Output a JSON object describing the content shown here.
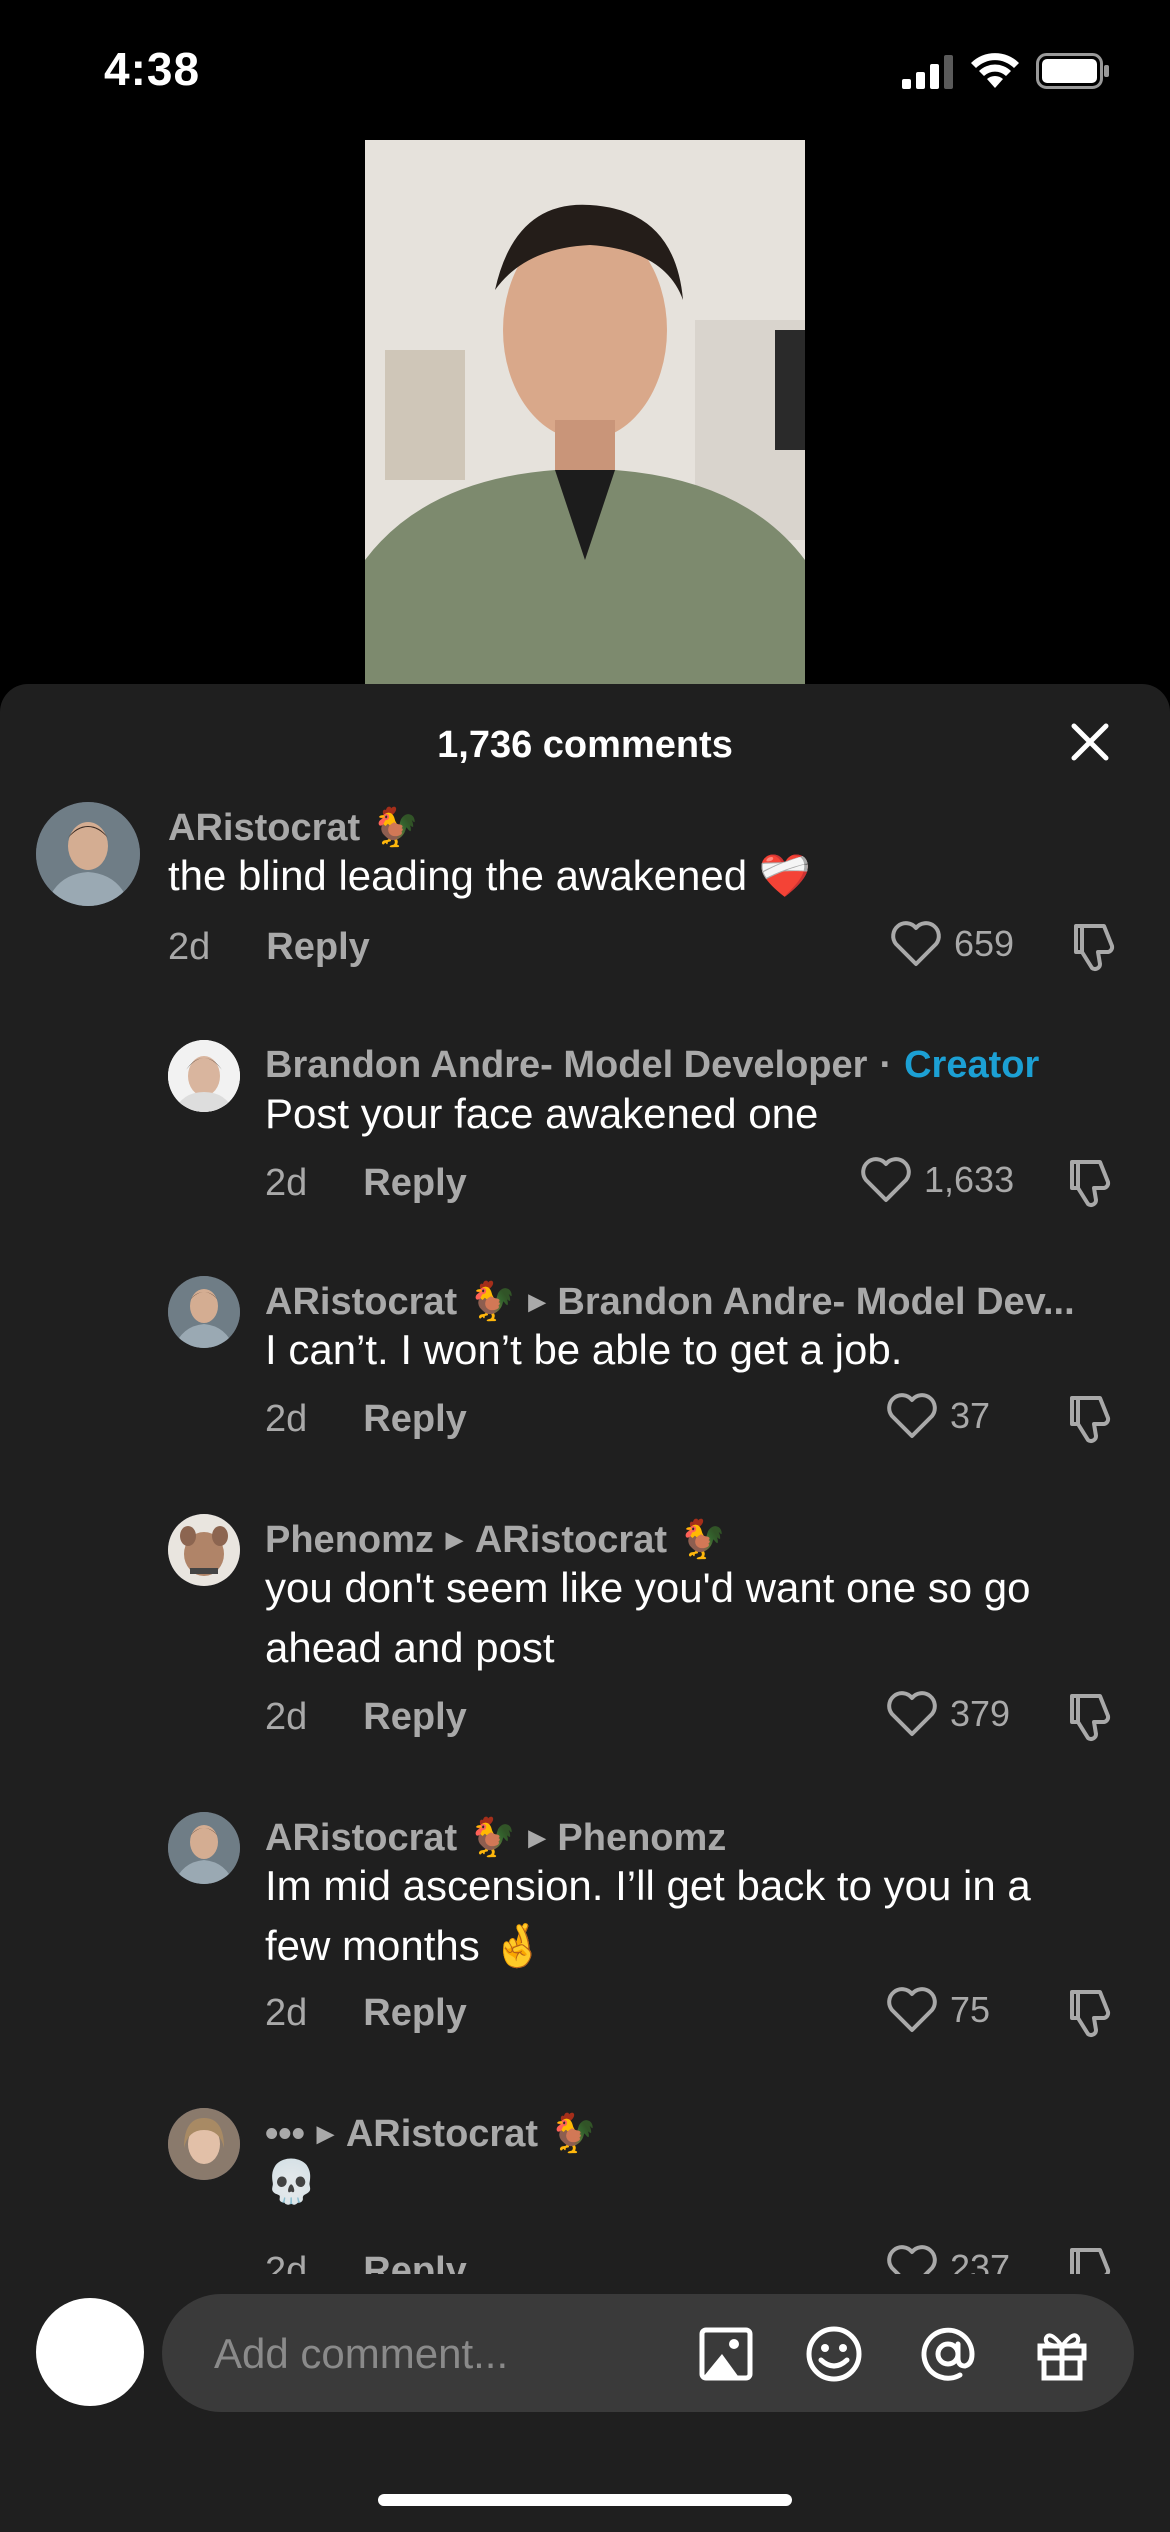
{
  "status": {
    "time": "4:38"
  },
  "sheet": {
    "title": "1,736 comments"
  },
  "comments": [
    {
      "author": "ARistocrat",
      "author_emoji": "🐓",
      "text": "the blind leading the awakened",
      "text_emoji": "❤️‍🩹",
      "age": "2d",
      "reply": "Reply",
      "likes": "659"
    },
    {
      "author": "Brandon Andre- Model Developer",
      "separator": "·",
      "badge": "Creator",
      "text": "Post your face awakened one",
      "age": "2d",
      "reply": "Reply",
      "likes": "1,633"
    },
    {
      "author": "ARistocrat",
      "author_emoji": "🐓",
      "reply_to": "Brandon Andre- Model Dev...",
      "text": "I can’t. I won’t be able to get a job.",
      "age": "2d",
      "reply": "Reply",
      "likes": "37"
    },
    {
      "author": "Phenomz",
      "reply_to": "ARistocrat",
      "reply_to_emoji": "🐓",
      "text_line1": "you don't seem like you'd want one so go",
      "text_line2": "ahead and post",
      "age": "2d",
      "reply": "Reply",
      "likes": "379"
    },
    {
      "author": "ARistocrat",
      "author_emoji": "🐓",
      "reply_to": "Phenomz",
      "text_line1": "Im mid ascension. I’ll get back to you in a",
      "text_line2": "few months",
      "text_emoji": "🤞",
      "age": "2d",
      "reply": "Reply",
      "likes": "75"
    },
    {
      "author": "•••",
      "reply_to": "ARistocrat",
      "reply_to_emoji": "🐓",
      "text": "💀",
      "age": "2d",
      "reply": "Reply",
      "likes": "237"
    }
  ],
  "composer": {
    "placeholder": "Add comment..."
  },
  "colors": {
    "sheet_bg": "#1f1f1f",
    "creator": "#1ca0d4",
    "muted": "#a9a9a9"
  }
}
